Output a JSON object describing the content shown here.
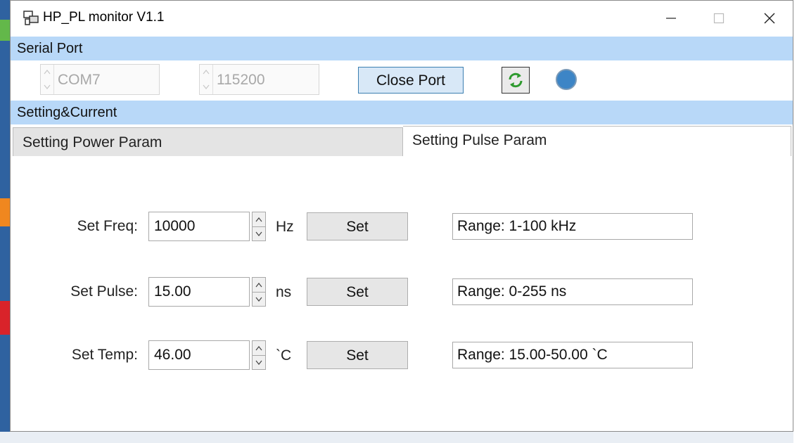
{
  "window": {
    "title": "HP_PL monitor V1.1"
  },
  "serial": {
    "section_label": "Serial Port",
    "port_value": "COM7",
    "baud_value": "115200",
    "close_label": "Close Port",
    "led_color": "#3d85c6"
  },
  "setting": {
    "section_label": "Setting&Current",
    "tabs": [
      {
        "label": "Setting Power Param",
        "active": false
      },
      {
        "label": "Setting Pulse Param",
        "active": true
      }
    ]
  },
  "rows": [
    {
      "label": "Set Freq:",
      "value": "10000",
      "unit": "Hz",
      "button": "Set",
      "range": "Range: 1-100 kHz"
    },
    {
      "label": "Set Pulse:",
      "value": "15.00",
      "unit": "ns",
      "button": "Set",
      "range": "Range: 0-255 ns"
    },
    {
      "label": "Set Temp:",
      "value": "46.00",
      "unit": "`C",
      "button": "Set",
      "range": "Range: 15.00-50.00 `C"
    }
  ],
  "colors": {
    "section_bar": "#b8d8f8",
    "accent": "#3c7fb1"
  },
  "icons": {
    "app": "app-monitor-icon",
    "refresh": "refresh-icon"
  }
}
